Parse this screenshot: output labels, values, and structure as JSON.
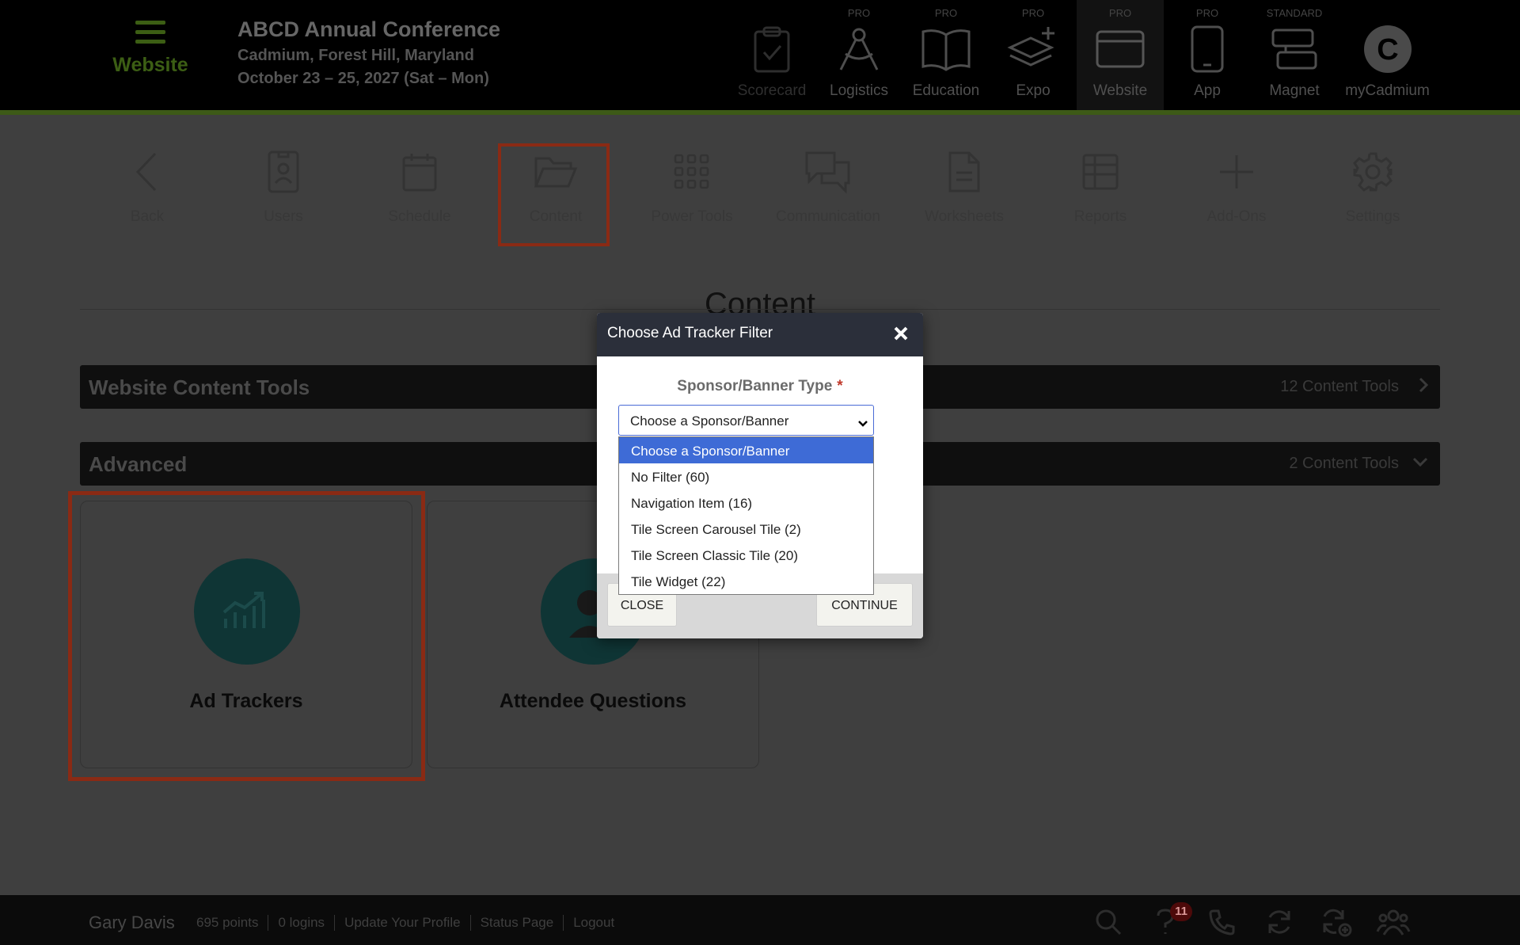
{
  "header": {
    "menu_label": "Website",
    "event_title": "ABCD Annual Conference",
    "event_location": "Cadmium, Forest Hill, Maryland",
    "event_dates": "October 23 – 25, 2027 (Sat – Mon)",
    "products": [
      {
        "tier": "",
        "label": "Scorecard",
        "icon": "clipboard-check-icon"
      },
      {
        "tier": "PRO",
        "label": "Logistics",
        "icon": "compass-icon"
      },
      {
        "tier": "PRO",
        "label": "Education",
        "icon": "open-book-icon"
      },
      {
        "tier": "PRO",
        "label": "Expo",
        "icon": "layers-plus-icon"
      },
      {
        "tier": "PRO",
        "label": "Website",
        "icon": "browser-window-icon",
        "active": true
      },
      {
        "tier": "PRO",
        "label": "App",
        "icon": "smartphone-icon"
      },
      {
        "tier": "STANDARD",
        "label": "Magnet",
        "icon": "magnet-icon"
      },
      {
        "tier": "",
        "label": "myCadmium",
        "icon": "cadmium-logo-icon"
      }
    ]
  },
  "toolbar": {
    "items": [
      {
        "label": "Back",
        "icon": "chevron-left-icon"
      },
      {
        "label": "Users",
        "icon": "id-badge-icon"
      },
      {
        "label": "Schedule",
        "icon": "calendar-icon"
      },
      {
        "label": "Content",
        "icon": "folder-open-icon",
        "selected": true
      },
      {
        "label": "Power Tools",
        "icon": "grid-dots-icon"
      },
      {
        "label": "Communication",
        "icon": "chat-bubbles-icon"
      },
      {
        "label": "Worksheets",
        "icon": "document-icon"
      },
      {
        "label": "Reports",
        "icon": "table-icon"
      },
      {
        "label": "Add-Ons",
        "icon": "plus-icon"
      },
      {
        "label": "Settings",
        "icon": "gear-icon"
      }
    ]
  },
  "main": {
    "title": "Content",
    "sections": [
      {
        "title": "Website Content Tools",
        "count": "12 Content Tools",
        "state": "collapsed"
      },
      {
        "title": "Advanced",
        "count": "2 Content Tools",
        "state": "expanded"
      }
    ],
    "cards": [
      {
        "label": "Ad Trackers",
        "icon": "chart-growth-icon"
      },
      {
        "label": "Attendee Questions",
        "icon": "person-icon"
      }
    ]
  },
  "modal": {
    "title": "Choose Ad Tracker Filter",
    "field_label": "Sponsor/Banner Type",
    "required_mark": "*",
    "select_value": "Choose a Sponsor/Banner",
    "options": [
      "Choose a Sponsor/Banner",
      "No Filter (60)",
      "Navigation Item (16)",
      "Tile Screen Carousel Tile (2)",
      "Tile Screen Classic Tile (20)",
      "Tile Widget (22)"
    ],
    "selected_option": "Choose a Sponsor/Banner",
    "close_label": "CLOSE",
    "continue_label": "CONTINUE"
  },
  "footer": {
    "user_name": "Gary Davis",
    "links": [
      "695 points",
      "0 logins",
      "Update Your Profile",
      "Status Page",
      "Logout"
    ],
    "icons": [
      "search-icon",
      "help-icon",
      "phone-icon",
      "refresh-icon",
      "sync-add-icon",
      "people-icon"
    ],
    "help_badge": "11"
  },
  "colors": {
    "accent_green": "#3c5e14",
    "highlight_red": "#8a2a14",
    "modal_header": "#2b2f3a",
    "option_selected": "#3e6bd6",
    "teal_circle": "#0f3535"
  }
}
